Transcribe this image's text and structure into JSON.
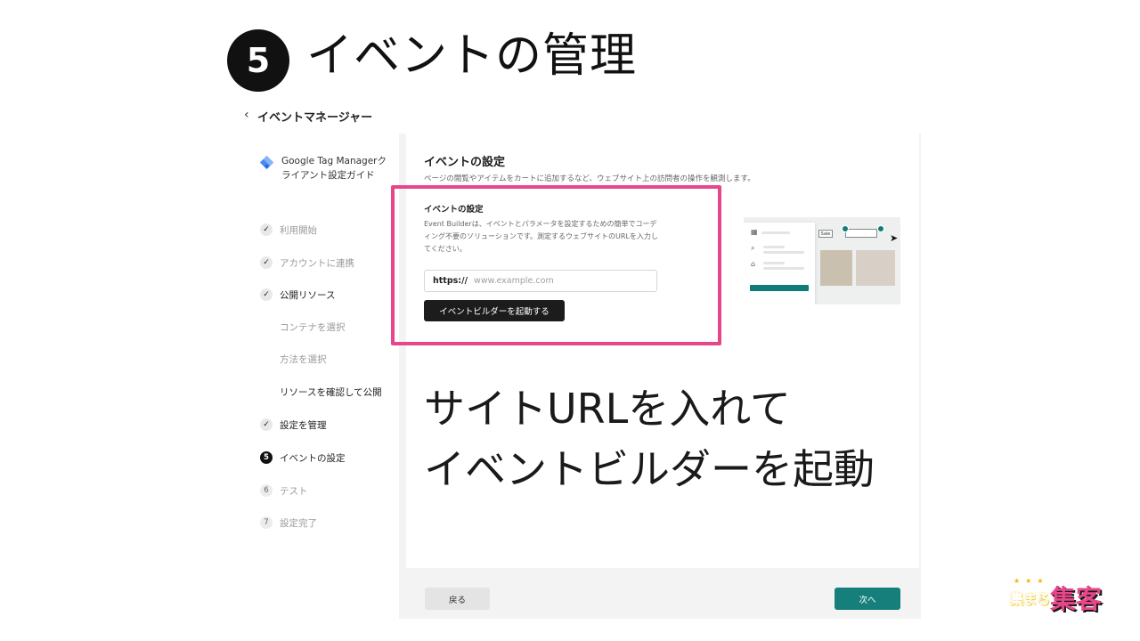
{
  "slide": {
    "step_number": "5",
    "title": "イベントの管理",
    "caption_line1": "サイトURLを入れて",
    "caption_line2": "イベントビルダーを起動"
  },
  "app": {
    "back_title": "イベントマネージャー"
  },
  "sidebar": {
    "guide_title": "Google Tag Managerクライアント設定ガイド",
    "items": [
      {
        "label": "利用開始",
        "state": "done"
      },
      {
        "label": "アカウントに連携",
        "state": "done"
      },
      {
        "label": "公開リソース",
        "state": "done"
      },
      {
        "label": "コンテナを選択",
        "state": "sub"
      },
      {
        "label": "方法を選択",
        "state": "sub"
      },
      {
        "label": "リソースを確認して公開",
        "state": "sub-active"
      },
      {
        "label": "設定を管理",
        "state": "done"
      },
      {
        "label": "イベントの設定",
        "state": "current",
        "number": "5"
      },
      {
        "label": "テスト",
        "state": "todo",
        "number": "6"
      },
      {
        "label": "設定完了",
        "state": "todo",
        "number": "7"
      }
    ]
  },
  "main": {
    "section_title": "イベントの設定",
    "section_desc": "ページの閲覧やアイテムをカートに追加するなど、ウェブサイト上の訪問者の操作を観測します。",
    "card_title": "イベントの設定",
    "card_desc": "Event Builderは、イベントとパラメータを設定するための簡単でコーディング不要のソリューションです。測定するウェブサイトのURLを入力してください。",
    "url_prefix": "https://",
    "url_placeholder": "www.example.com",
    "url_value": "",
    "launch_button": "イベントビルダーを起動する"
  },
  "illustration": {
    "sale_label": "Sale"
  },
  "footer": {
    "back_button": "戻る",
    "next_button": "次へ"
  },
  "logo": {
    "small_text": "集まる",
    "big_text": "集客"
  },
  "colors": {
    "highlight": "#e8468a",
    "primary_teal": "#177f7b",
    "dark_button": "#1c1c1c"
  }
}
